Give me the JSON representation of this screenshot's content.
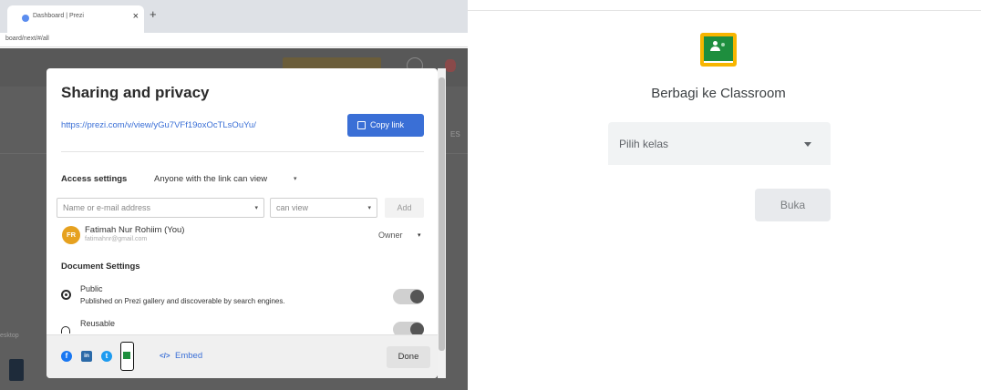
{
  "browser": {
    "tab_title": "Dashboard | Prezi",
    "tab_close": "×",
    "new_tab": "+",
    "url": "board/next/#/all"
  },
  "background": {
    "side_text": "esktop",
    "right_text": "ES"
  },
  "modal": {
    "title": "Sharing and privacy",
    "share_link": "https://prezi.com/v/view/yGu7VFf19oxOcTLsOuYu/",
    "copy_label": "Copy link",
    "access_label": "Access settings",
    "access_value": "Anyone with the link can view",
    "name_placeholder": "Name or e-mail address",
    "permission_value": "can view",
    "add_label": "Add",
    "user": {
      "initials": "FR",
      "name": "Fatimah Nur Rohiim (You)",
      "email": "fatimahnr@gmail.com",
      "role": "Owner"
    },
    "doc_settings_label": "Document Settings",
    "public_label": "Public",
    "public_desc": "Published on Prezi gallery and discoverable by search engines.",
    "reusable_label": "Reusable",
    "embed_icon": "</>",
    "embed_label": "Embed",
    "done_label": "Done",
    "social": {
      "facebook": "f",
      "linkedin": "in",
      "twitter": "t"
    },
    "caret": "▾"
  },
  "classroom": {
    "title": "Berbagi ke Classroom",
    "class_placeholder": "Pilih kelas",
    "open_label": "Buka"
  },
  "colors": {
    "accent": "#3a6fd6",
    "classroom_green": "#1e8e3e",
    "classroom_yellow": "#f7b500"
  }
}
